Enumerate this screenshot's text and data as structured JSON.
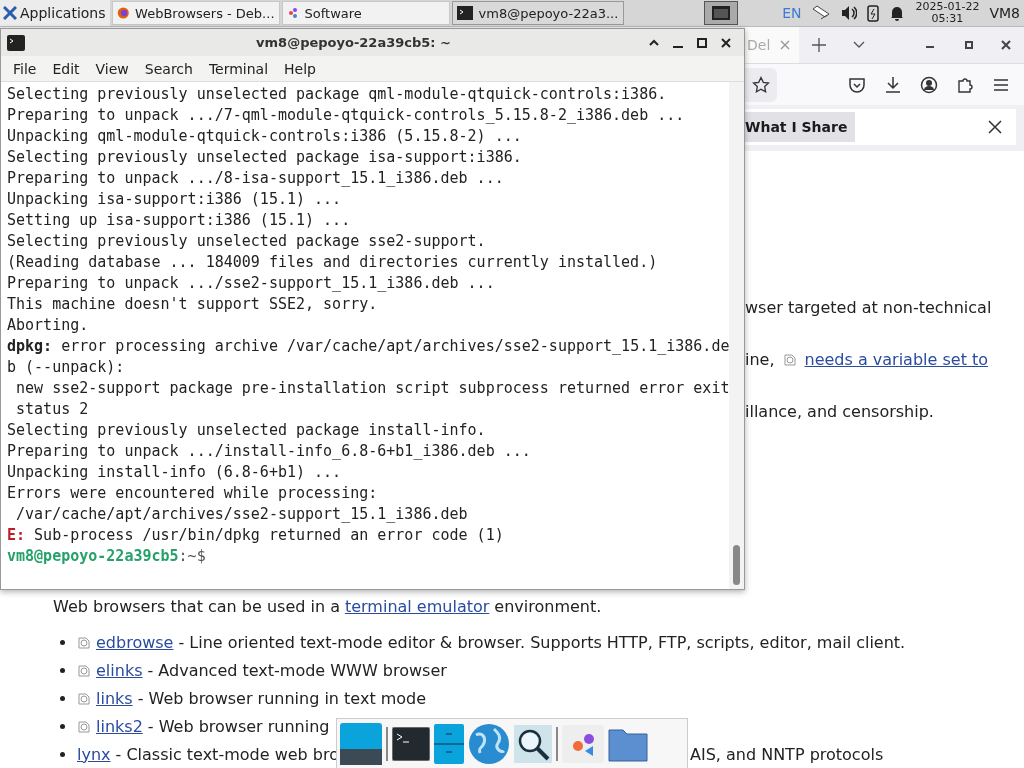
{
  "panel": {
    "app_menu": "Applications",
    "tasks": [
      {
        "label": "WebBrowsers - Deb...",
        "kind": "browser",
        "selected": false
      },
      {
        "label": "Software",
        "kind": "software",
        "selected": false
      },
      {
        "label": "vm8@pepoyo-22a3...",
        "kind": "terminal",
        "selected": true
      }
    ],
    "language": "EN",
    "date": "2025-01-22",
    "time": "05:31",
    "user": "VM8"
  },
  "browser": {
    "tab_fragment": "Del",
    "notification": {
      "button": "What I Share"
    },
    "fragments": [
      {
        "text": "wser targeted at non-technical"
      },
      {
        "text": "ine,",
        "link": "needs a variable set to"
      },
      {
        "text": "illance, and censorship."
      }
    ],
    "intro": {
      "before": "Web browsers that can be used in a",
      "link": "terminal emulator",
      "after": "environment."
    },
    "items": [
      {
        "link": "edbrowse",
        "desc": "- Line oriented text-mode editor & browser. Supports HTTP, FTP, scripts, editor, mail client.",
        "icon": true
      },
      {
        "link": "elinks",
        "desc": "- Advanced text-mode WWW browser",
        "icon": true
      },
      {
        "link": "links",
        "desc": "- Web browser running in text mode",
        "icon": true
      },
      {
        "link": "links2",
        "desc": "- Web browser running",
        "icon": true
      },
      {
        "link": "lynx",
        "desc": "- Classic text-mode web bro",
        "tail": "AIS, and NNTP protocols",
        "icon": false
      }
    ]
  },
  "terminal": {
    "title": "vm8@pepoyo-22a39cb5: ~",
    "menu": [
      "File",
      "Edit",
      "View",
      "Search",
      "Terminal",
      "Help"
    ],
    "lines": [
      {
        "kind": "plain",
        "text": "Selecting previously unselected package qml-module-qtquick-controls:i386."
      },
      {
        "kind": "plain",
        "text": "Preparing to unpack .../7-qml-module-qtquick-controls_5.15.8-2_i386.deb ..."
      },
      {
        "kind": "plain",
        "text": "Unpacking qml-module-qtquick-controls:i386 (5.15.8-2) ..."
      },
      {
        "kind": "plain",
        "text": "Selecting previously unselected package isa-support:i386."
      },
      {
        "kind": "plain",
        "text": "Preparing to unpack .../8-isa-support_15.1_i386.deb ..."
      },
      {
        "kind": "plain",
        "text": "Unpacking isa-support:i386 (15.1) ..."
      },
      {
        "kind": "plain",
        "text": "Setting up isa-support:i386 (15.1) ..."
      },
      {
        "kind": "plain",
        "text": "Selecting previously unselected package sse2-support."
      },
      {
        "kind": "plain",
        "text": "(Reading database ... 184009 files and directories currently installed.)"
      },
      {
        "kind": "plain",
        "text": "Preparing to unpack .../sse2-support_15.1_i386.deb ..."
      },
      {
        "kind": "plain",
        "text": "This machine doesn't support SSE2, sorry."
      },
      {
        "kind": "plain",
        "text": "Aborting."
      },
      {
        "kind": "label",
        "prefix": "dpkg:",
        "text": " error processing archive /var/cache/apt/archives/sse2-support_15.1_i386.de"
      },
      {
        "kind": "plain",
        "text": "b (--unpack):"
      },
      {
        "kind": "plain",
        "text": " new sse2-support package pre-installation script subprocess returned error exit"
      },
      {
        "kind": "plain",
        "text": " status 2"
      },
      {
        "kind": "plain",
        "text": "Selecting previously unselected package install-info."
      },
      {
        "kind": "plain",
        "text": "Preparing to unpack .../install-info_6.8-6+b1_i386.deb ..."
      },
      {
        "kind": "plain",
        "text": "Unpacking install-info (6.8-6+b1) ..."
      },
      {
        "kind": "plain",
        "text": "Errors were encountered while processing:"
      },
      {
        "kind": "plain",
        "text": " /var/cache/apt/archives/sse2-support_15.1_i386.deb"
      },
      {
        "kind": "error",
        "prefix": "E:",
        "text": " Sub-process /usr/bin/dpkg returned an error code (1)"
      },
      {
        "kind": "prompt",
        "prefix": "vm8@pepoyo-22a39cb5",
        "text": ":~$"
      }
    ]
  }
}
